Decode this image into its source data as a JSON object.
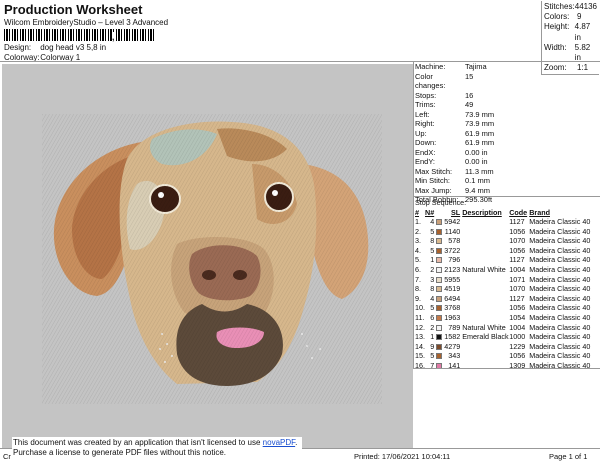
{
  "header": {
    "title": "Production Worksheet",
    "subtitle": "Wilcom EmbroideryStudio – Level 3 Advanced",
    "barcode_sep": ",",
    "design_label": "Design:",
    "design_value": "dog head v3 5,8 in",
    "colorway_label": "Colorway:",
    "colorway_value": "Colorway 1"
  },
  "summary": [
    {
      "k": "Stitches:",
      "v": "44136"
    },
    {
      "k": "Colors:",
      "v": "9"
    },
    {
      "k": "Height:",
      "v": "4.87 in"
    },
    {
      "k": "Width:",
      "v": "5.82 in"
    },
    {
      "k": "Zoom:",
      "v": "1:1"
    }
  ],
  "machine": [
    {
      "k": "Machine:",
      "v": "Tajima"
    },
    {
      "k": "Color changes:",
      "v": "15"
    },
    {
      "k": "Stops:",
      "v": "16"
    },
    {
      "k": "Trims:",
      "v": "49"
    },
    {
      "k": "Left:",
      "v": "73.9 mm"
    },
    {
      "k": "Right:",
      "v": "73.9 mm"
    },
    {
      "k": "Up:",
      "v": "61.9 mm"
    },
    {
      "k": "Down:",
      "v": "61.9 mm"
    },
    {
      "k": "EndX:",
      "v": "0.00 in"
    },
    {
      "k": "EndY:",
      "v": "0.00 in"
    },
    {
      "k": "Max Stitch:",
      "v": "11.3 mm"
    },
    {
      "k": "Min Stitch:",
      "v": "0.1 mm"
    },
    {
      "k": "Max Jump:",
      "v": "9.4 mm"
    },
    {
      "k": "Total Bobbin:",
      "v": "295.30ft"
    }
  ],
  "stops": {
    "title": "Stop Sequence:",
    "headers": {
      "num": "#",
      "n": "N#",
      "sl": "SL",
      "desc": "Description",
      "code": "Code",
      "brand": "Brand"
    },
    "rows": [
      {
        "num": "1.",
        "n": "4",
        "color": "#c9a07a",
        "sl": "5942",
        "desc": "",
        "code": "1127",
        "brand": "Madeira Classic 40"
      },
      {
        "num": "2.",
        "n": "5",
        "color": "#a8622e",
        "sl": "1140",
        "desc": "",
        "code": "1056",
        "brand": "Madeira Classic 40"
      },
      {
        "num": "3.",
        "n": "8",
        "color": "#d9b990",
        "sl": "578",
        "desc": "",
        "code": "1070",
        "brand": "Madeira Classic 40"
      },
      {
        "num": "4.",
        "n": "5",
        "color": "#a8622e",
        "sl": "3722",
        "desc": "",
        "code": "1056",
        "brand": "Madeira Classic 40"
      },
      {
        "num": "5.",
        "n": "1",
        "color": "#e8b9a8",
        "sl": "796",
        "desc": "",
        "code": "1127",
        "brand": "Madeira Classic 40"
      },
      {
        "num": "6.",
        "n": "2",
        "color": "#f4f4f4",
        "sl": "2123",
        "desc": "Natural White",
        "code": "1004",
        "brand": "Madeira Classic 40"
      },
      {
        "num": "7.",
        "n": "3",
        "color": "#e9ddc8",
        "sl": "5955",
        "desc": "",
        "code": "1071",
        "brand": "Madeira Classic 40"
      },
      {
        "num": "8.",
        "n": "8",
        "color": "#d9b990",
        "sl": "4519",
        "desc": "",
        "code": "1070",
        "brand": "Madeira Classic 40"
      },
      {
        "num": "9.",
        "n": "4",
        "color": "#c9a07a",
        "sl": "6494",
        "desc": "",
        "code": "1127",
        "brand": "Madeira Classic 40"
      },
      {
        "num": "10.",
        "n": "5",
        "color": "#a8622e",
        "sl": "3768",
        "desc": "",
        "code": "1056",
        "brand": "Madeira Classic 40"
      },
      {
        "num": "11.",
        "n": "6",
        "color": "#c47a4a",
        "sl": "1963",
        "desc": "",
        "code": "1054",
        "brand": "Madeira Classic 40"
      },
      {
        "num": "12.",
        "n": "2",
        "color": "#f4f4f4",
        "sl": "789",
        "desc": "Natural White",
        "code": "1004",
        "brand": "Madeira Classic 40"
      },
      {
        "num": "13.",
        "n": "1",
        "color": "#111111",
        "sl": "1582",
        "desc": "Emerald Black",
        "code": "1000",
        "brand": "Madeira Classic 40"
      },
      {
        "num": "14.",
        "n": "9",
        "color": "#7b4a2a",
        "sl": "4279",
        "desc": "",
        "code": "1229",
        "brand": "Madeira Classic 40"
      },
      {
        "num": "15.",
        "n": "5",
        "color": "#a8622e",
        "sl": "343",
        "desc": "",
        "code": "1056",
        "brand": "Madeira Classic 40"
      },
      {
        "num": "16.",
        "n": "7",
        "color": "#e07aa6",
        "sl": "141",
        "desc": "",
        "code": "1309",
        "brand": "Madeira Classic 40"
      }
    ]
  },
  "notice": {
    "line1_pre": "This document was created by an application that isn't licensed to use ",
    "link": "novaPDF",
    "line1_post": ".",
    "line2": "Purchase a license to generate PDF files without this notice."
  },
  "footer": {
    "left": "Cr",
    "printed": "Printed: 17/06/2021 10:04:11",
    "page": "Page 1 of 1"
  }
}
